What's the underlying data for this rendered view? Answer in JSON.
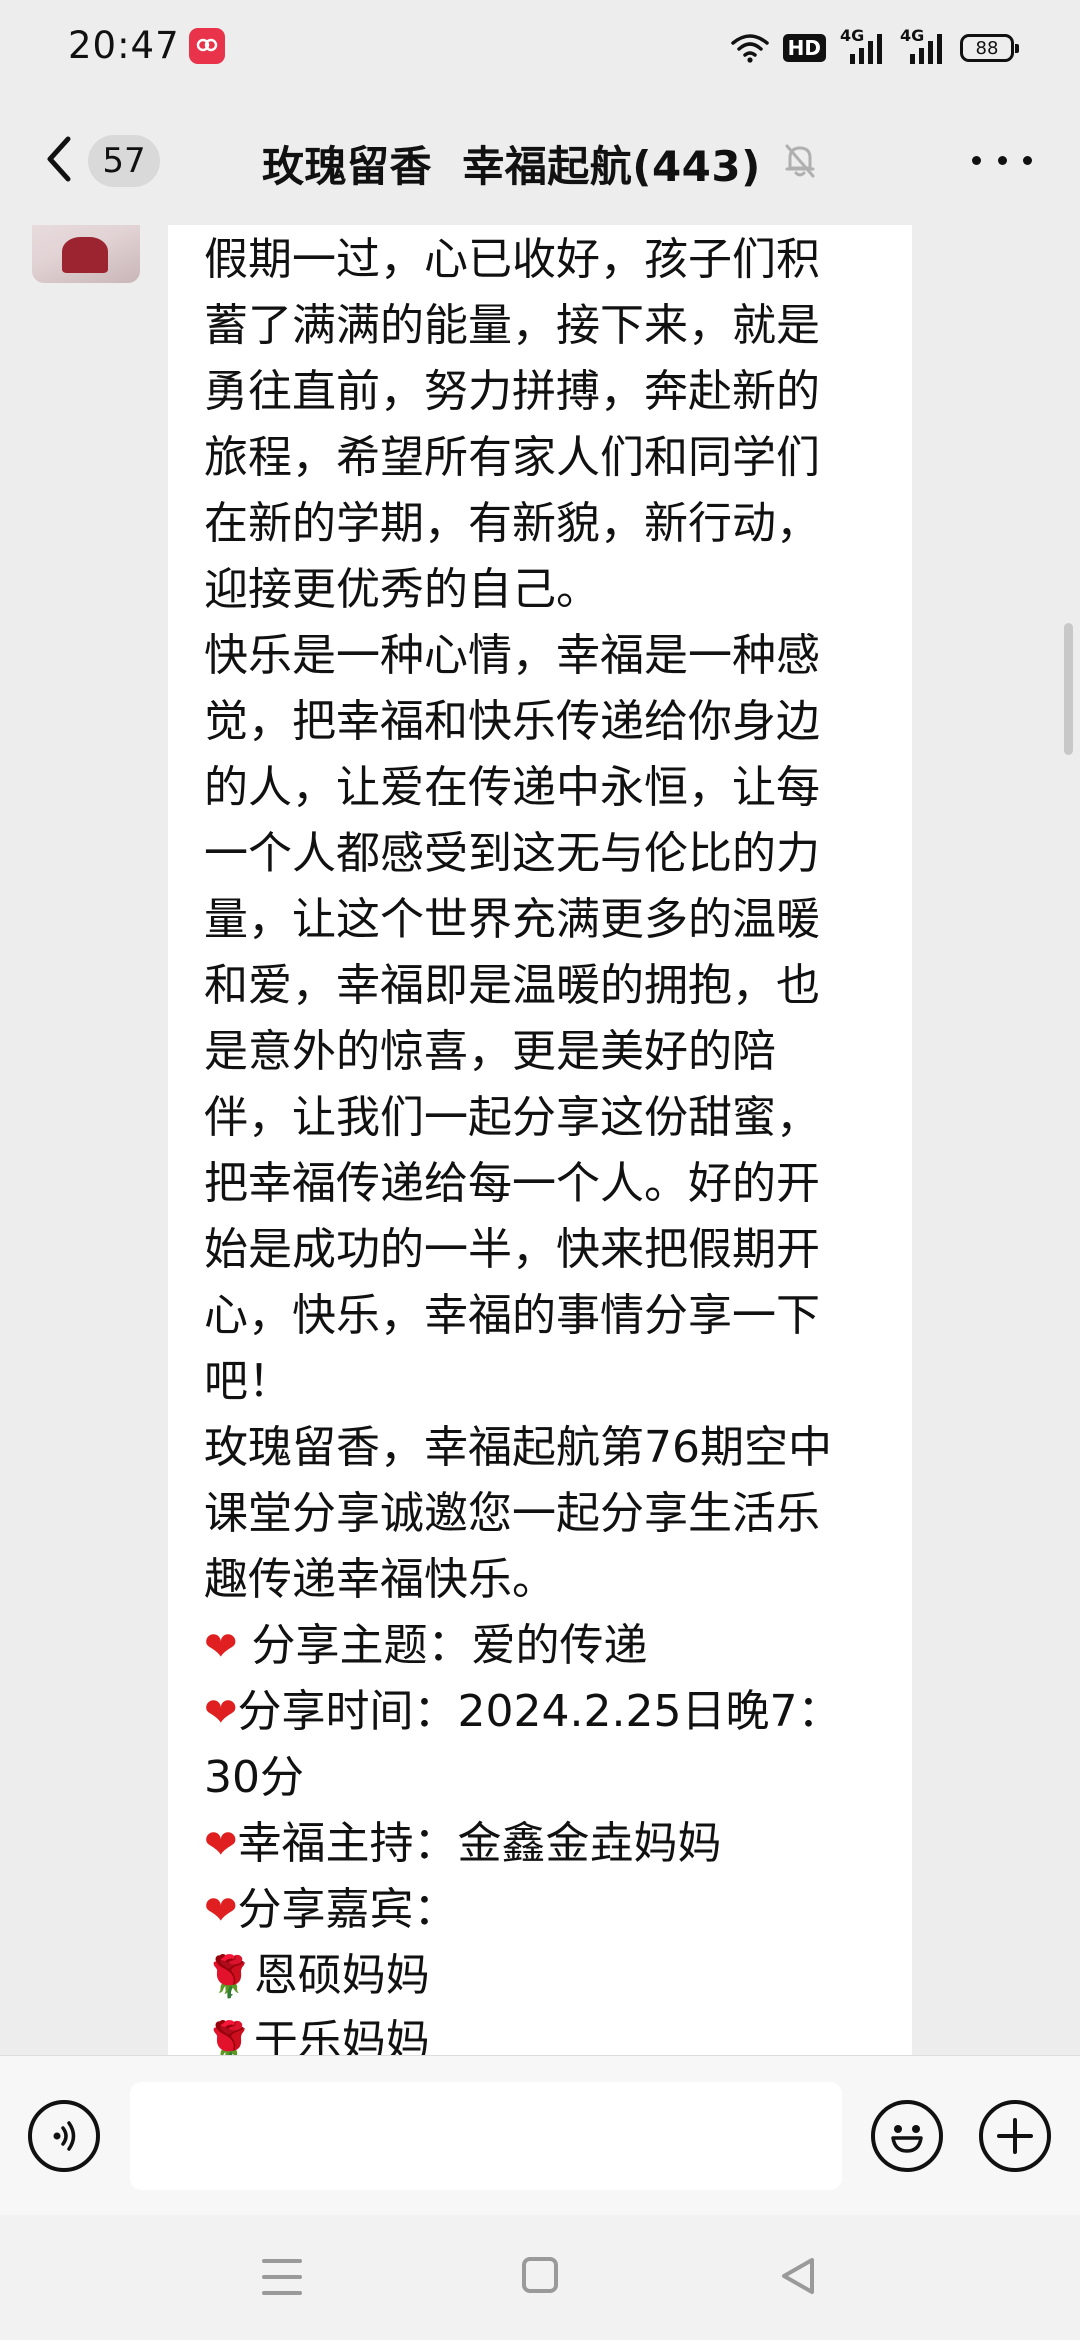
{
  "status_bar": {
    "time": "20:47",
    "app_notification_icon": "red-app-badge-icon",
    "wifi_icon": "wifi-icon",
    "hd_label": "HD",
    "signal1_label": "4G",
    "signal2_label": "4G",
    "battery_level": "88"
  },
  "header": {
    "unread_count": "57",
    "title": "玫瑰留香  幸福起航(443)",
    "muted_icon": "bell-muted-icon",
    "more_icon": "more-dots-icon"
  },
  "message": {
    "lines": [
      "假期一过，心已收好，孩子们积",
      "蓄了满满的能量，接下来，就是",
      "勇往直前，努力拼搏，奔赴新的",
      "旅程，希望所有家人们和同学们",
      "在新的学期，有新貌，新行动，",
      "迎接更优秀的自己。",
      "快乐是一种心情，幸福是一种感",
      "觉，把幸福和快乐传递给你身边",
      "的人，让爱在传递中永恒，让每",
      "一个人都感受到这无与伦比的力",
      "量，让这个世界充满更多的温暖",
      "和爱，幸福即是温暖的拥抱，也",
      "是意外的惊喜，更是美好的陪",
      "伴，让我们一起分享这份甜蜜，",
      "把幸福传递给每一个人。好的开",
      "始是成功的一半，快来把假期开",
      "心，快乐，幸福的事情分享一下",
      "吧！",
      "玫瑰留香，幸福起航第76期空中",
      "课堂分享诚邀您一起分享生活乐",
      "趣传递幸福快乐。"
    ],
    "heart_symbol": "❤",
    "rose_symbol": "🌹",
    "topic_line": "分享主题：爱的传递",
    "time_line_1": "分享时间：2024.2.25日晚7：",
    "time_line_2": "30分",
    "host_line": "幸福主持：金鑫金垚妈妈",
    "guests_line": "分享嘉宾：",
    "guest_1": "恩硕妈妈",
    "guest_2": "于乐妈妈"
  },
  "input_bar": {
    "voice_icon": "voice-input-icon",
    "input_value": "",
    "emoji_icon": "emoji-icon",
    "add_icon": "plus-icon"
  },
  "nav_bar": {
    "menu_icon": "menu-icon",
    "home_icon": "home-square-icon",
    "back_icon": "back-triangle-icon"
  }
}
